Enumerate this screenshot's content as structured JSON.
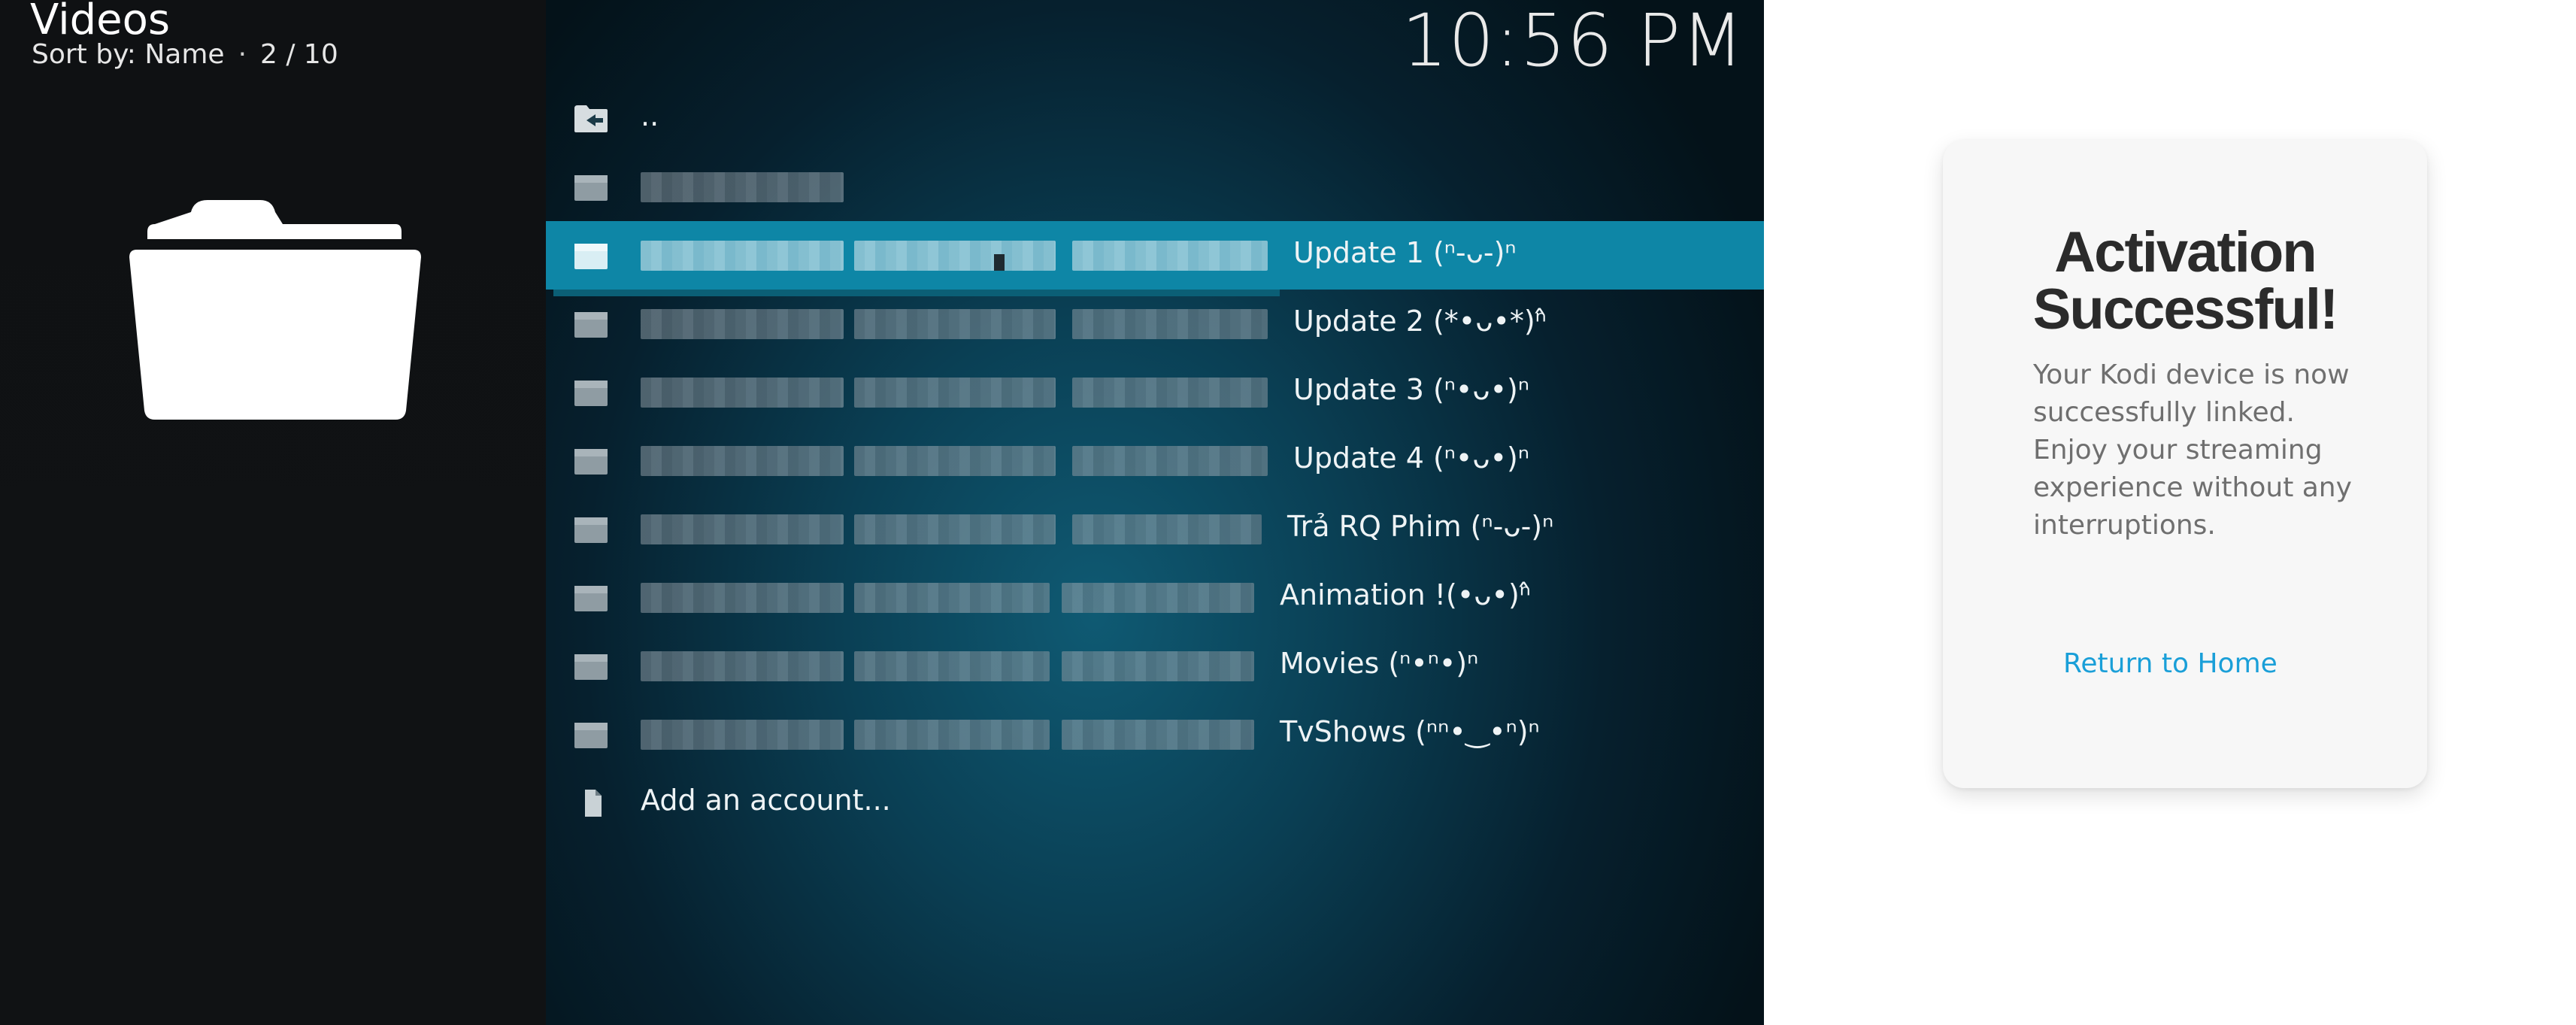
{
  "kodi": {
    "window_title": "Videos",
    "sort_label": "Sort by: Name",
    "sort_sep": "·",
    "position": "2 / 10",
    "clock": "10:56 PM",
    "items": [
      {
        "label": "..",
        "icon": "folder-back-icon"
      },
      {
        "label": "",
        "icon": "folder-icon"
      },
      {
        "label": "Update 1 (ⁿ-ᴗ-)ⁿ",
        "icon": "folder-icon",
        "selected": true
      },
      {
        "label": "Update 2 (*•ᴗ•*)ⁿ̂",
        "icon": "folder-icon"
      },
      {
        "label": "Update 3 (ⁿ•ᴗ•)ⁿ",
        "icon": "folder-icon"
      },
      {
        "label": "Update 4 (ⁿ•ᴗ•)ⁿ",
        "icon": "folder-icon"
      },
      {
        "label": "Trả RQ Phim (ⁿ-ᴗ-)ⁿ",
        "icon": "folder-icon"
      },
      {
        "label": "Animation !(•ᴗ•)ⁿ̂",
        "icon": "folder-icon"
      },
      {
        "label": "Movies (ⁿ•ⁿ•)ⁿ",
        "icon": "folder-icon"
      },
      {
        "label": "TvShows (ⁿⁿ•‿•ⁿ)ⁿ",
        "icon": "folder-icon"
      },
      {
        "label": "Add an account...",
        "icon": "file-icon"
      }
    ]
  },
  "activation": {
    "title": "Activation Successful!",
    "message": "Your Kodi device is now successfully linked. Enjoy your streaming experience without any interruptions.",
    "return_link": "Return to Home"
  },
  "colors": {
    "selected_row": "#0e86a6",
    "link": "#1a9fd8",
    "title_text": "#2b2b2b"
  }
}
